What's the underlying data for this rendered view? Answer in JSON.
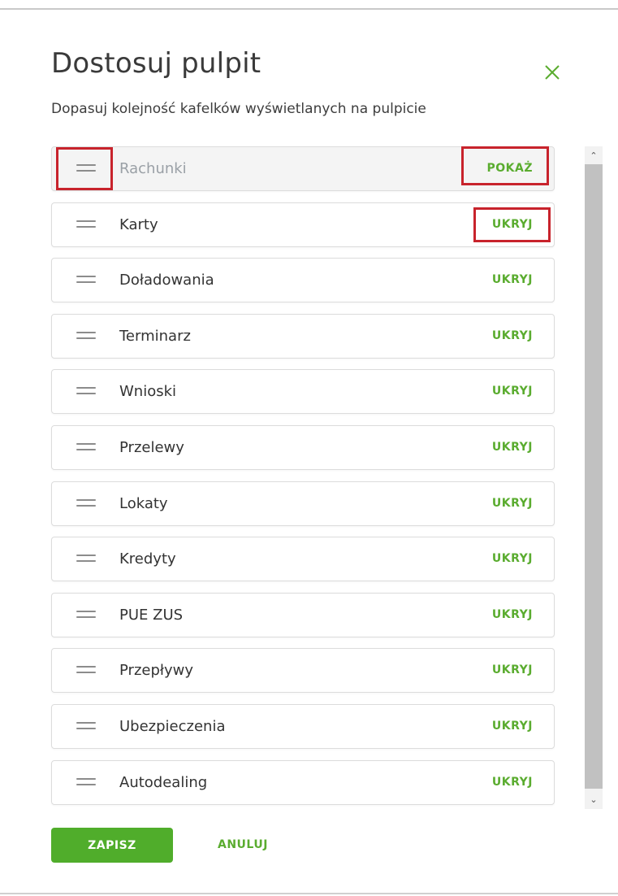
{
  "dialog": {
    "title": "Dostosuj pulpit",
    "subtitle": "Dopasuj kolejność kafelków wyświetlanych na pulpicie"
  },
  "tiles": [
    {
      "label": "Rachunki",
      "action": "POKAŻ",
      "hidden": true
    },
    {
      "label": "Karty",
      "action": "UKRYJ",
      "hidden": false
    },
    {
      "label": "Doładowania",
      "action": "UKRYJ",
      "hidden": false
    },
    {
      "label": "Terminarz",
      "action": "UKRYJ",
      "hidden": false
    },
    {
      "label": "Wnioski",
      "action": "UKRYJ",
      "hidden": false
    },
    {
      "label": "Przelewy",
      "action": "UKRYJ",
      "hidden": false
    },
    {
      "label": "Lokaty",
      "action": "UKRYJ",
      "hidden": false
    },
    {
      "label": "Kredyty",
      "action": "UKRYJ",
      "hidden": false
    },
    {
      "label": "PUE ZUS",
      "action": "UKRYJ",
      "hidden": false
    },
    {
      "label": "Przepływy",
      "action": "UKRYJ",
      "hidden": false
    },
    {
      "label": "Ubezpieczenia",
      "action": "UKRYJ",
      "hidden": false
    },
    {
      "label": "Autodealing",
      "action": "UKRYJ",
      "hidden": false
    }
  ],
  "footer": {
    "save_label": "ZAPISZ",
    "cancel_label": "ANULUJ"
  },
  "icons": {
    "close": "close-icon",
    "handle": "drag-handle-icon",
    "scroll_up": "chevron-up-icon",
    "scroll_down": "chevron-down-icon"
  },
  "colors": {
    "accent": "#5aac2f",
    "button": "#50ad2b",
    "highlight": "#c8232c"
  }
}
